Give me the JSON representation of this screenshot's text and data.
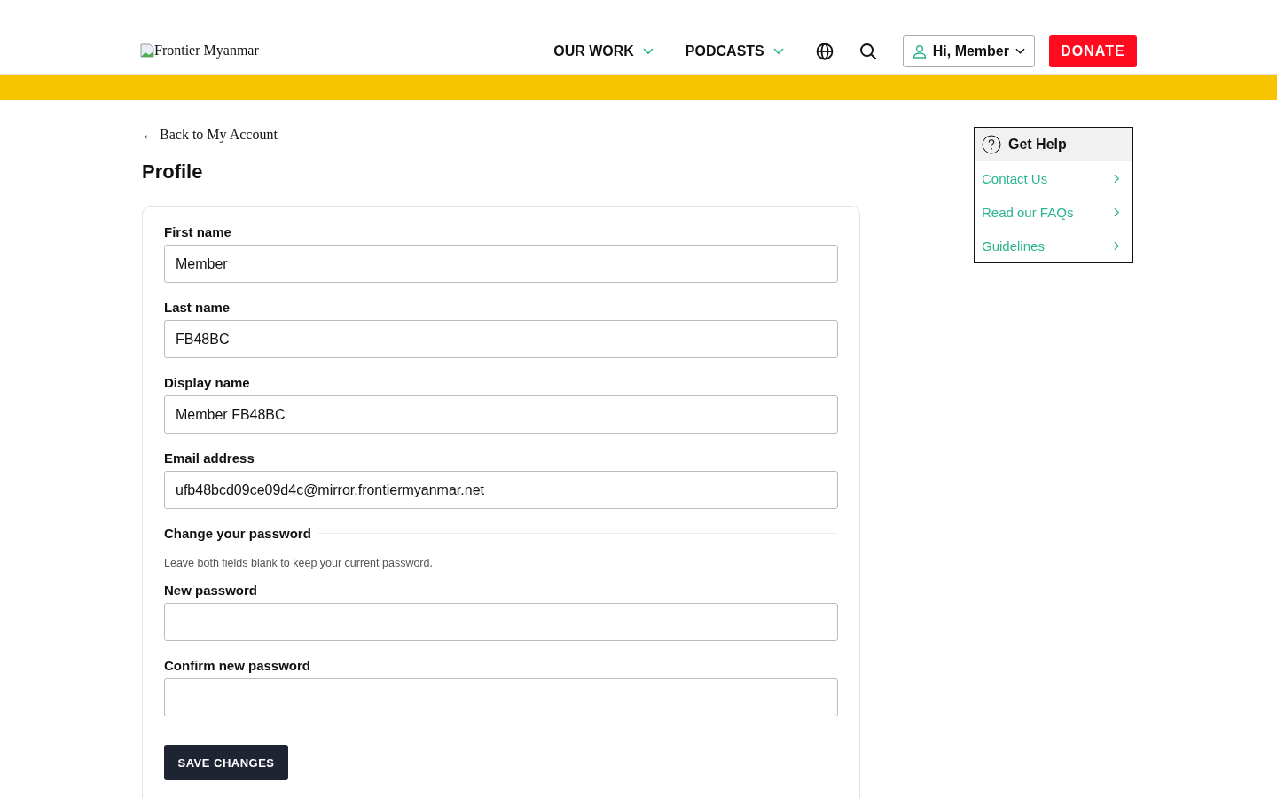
{
  "header": {
    "logo_alt": "Frontier Myanmar",
    "nav": [
      {
        "label": "OUR WORK",
        "has_dropdown": true
      },
      {
        "label": "PODCASTS",
        "has_dropdown": true
      }
    ],
    "account_button": "Hi, Member",
    "donate_button": "DONATE"
  },
  "back_link": "Back to My Account",
  "back_arrow": "←",
  "page_title": "Profile",
  "form": {
    "fields": [
      {
        "label": "First name",
        "value": "Member"
      },
      {
        "label": "Last name",
        "value": "FB48BC"
      },
      {
        "label": "Display name",
        "value": "Member FB48BC"
      },
      {
        "label": "Email address",
        "value": "ufb48bcd09ce09d4c@mirror.frontiermyanmar.net"
      }
    ],
    "password_section": {
      "title": "Change your password",
      "hint": "Leave both fields blank to keep your current password.",
      "fields": [
        {
          "label": "New password"
        },
        {
          "label": "Confirm new password"
        }
      ]
    },
    "submit_button": "SAVE CHANGES"
  },
  "help": {
    "title": "Get Help",
    "links": [
      {
        "label": "Contact Us"
      },
      {
        "label": "Read our FAQs"
      },
      {
        "label": "Guidelines"
      }
    ]
  }
}
